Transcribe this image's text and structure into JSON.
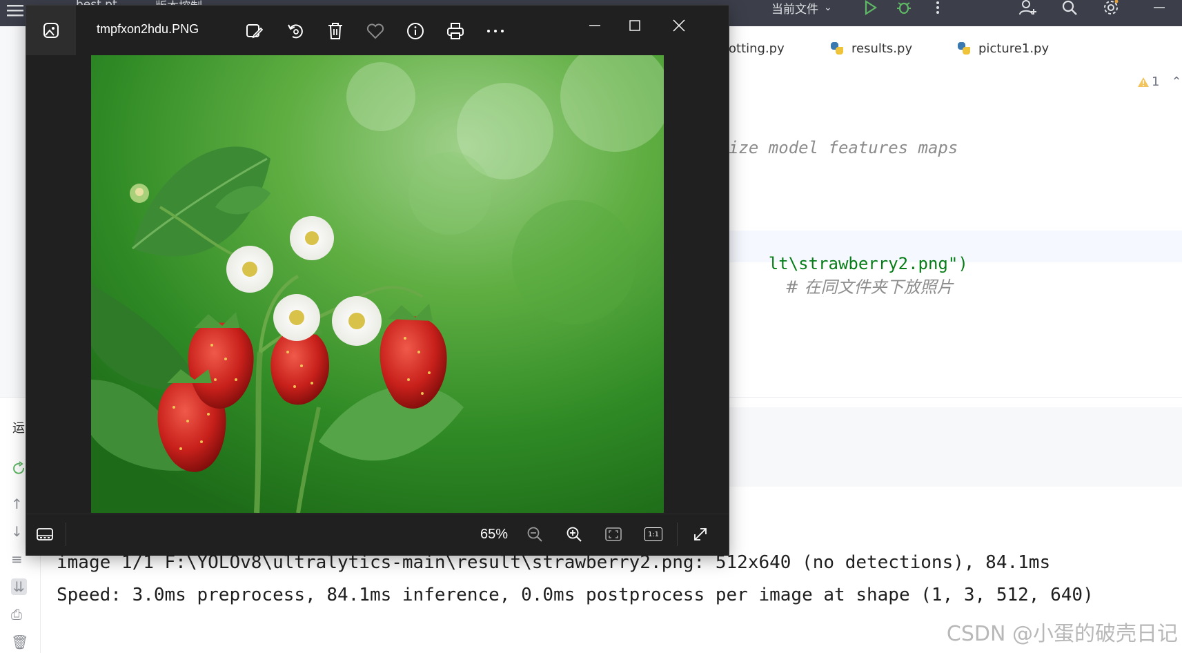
{
  "ide": {
    "topbar": {
      "project_label": "best.pt",
      "vcs_label": "版本控制",
      "run_config": "当前文件"
    },
    "tabs": [
      {
        "label": "otting.py"
      },
      {
        "label": "results.py"
      },
      {
        "label": "picture1.py"
      }
    ],
    "editor": {
      "warning_count": "1",
      "line_comment_fragment": "ize model features maps",
      "line_code_fragment": "lt\\strawberry2.png\")",
      "line_code_comment": "# 在同文件夹下放照片"
    },
    "run_panel": {
      "tab_label": "运",
      "console_lines": [
        "image 1/1 F:\\YOLOv8\\ultralytics-main\\result\\strawberry2.png: 512x640 (no detections), 84.1ms",
        "Speed: 3.0ms preprocess, 84.1ms inference, 0.0ms postprocess per image at shape (1, 3, 512, 640)"
      ]
    },
    "watermark": "CSDN @小蛋的破壳日记"
  },
  "viewer": {
    "filename": "tmpfxon2hdu.PNG",
    "zoom_level": "65%",
    "toolbar_icons": [
      "edit-image-icon",
      "rotate-icon",
      "delete-icon",
      "favorite-icon",
      "info-icon",
      "print-icon",
      "more-icon"
    ],
    "bottom_icons": [
      "filmstrip-icon",
      "zoom-out-icon",
      "zoom-in-icon",
      "fit-to-window-icon",
      "actual-size-icon",
      "fullscreen-icon"
    ],
    "actual_size_label": "1:1",
    "colors": {
      "background": "#202020",
      "titlebar_icon_bg": "#2d2d2d"
    }
  }
}
